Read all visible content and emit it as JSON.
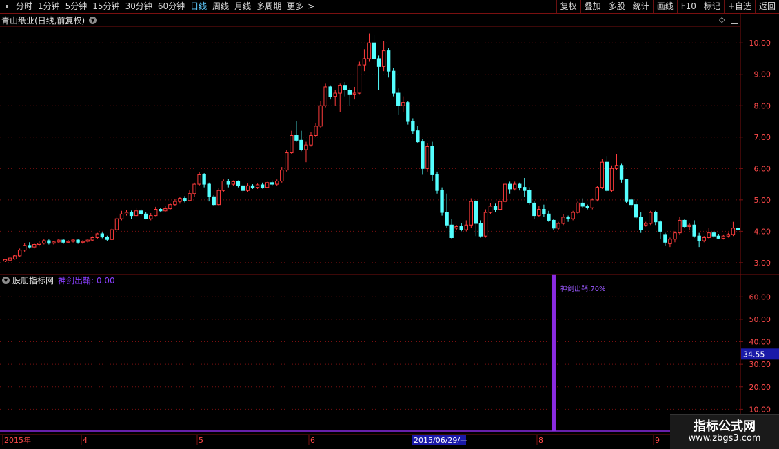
{
  "toolbar": {
    "periods": [
      "分时",
      "1分钟",
      "5分钟",
      "15分钟",
      "30分钟",
      "60分钟",
      "日线",
      "周线",
      "月线",
      "多周期",
      "更多"
    ],
    "active_period": "日线",
    "right_buttons": [
      "复权",
      "叠加",
      "多股",
      "统计",
      "画线",
      "F10",
      "标记",
      "+自选",
      "返回"
    ]
  },
  "main_title": "青山纸业(日线,前复权)",
  "sub_panel": {
    "name": "股朋指标网",
    "indicator": "神剑出鞘: 0.00",
    "spike_label": "神剑出鞘:70%",
    "current_value": "34.55"
  },
  "x_axis": {
    "labels": [
      "2015年",
      "4",
      "5",
      "6",
      "2015/06/29/—",
      "8",
      "9"
    ]
  },
  "watermark": {
    "title": "指标公式网",
    "url": "www.zbgs3.com"
  },
  "colors": {
    "up": "#ff3c3c",
    "down": "#54ffff",
    "grid": "#7a1010",
    "axis_text": "#ff4a4a",
    "indicator": "#8a2be2",
    "bg": "#000000"
  },
  "chart_data": {
    "type": "candlestick",
    "main": {
      "ylim": [
        2.8,
        10.4
      ],
      "yticks": [
        "3.00",
        "4.00",
        "5.00",
        "6.00",
        "7.00",
        "8.00",
        "9.00",
        "10.00"
      ],
      "candles": [
        [
          3.05,
          3.1,
          3.02,
          3.12
        ],
        [
          3.08,
          3.15,
          3.05,
          3.18
        ],
        [
          3.12,
          3.22,
          3.1,
          3.25
        ],
        [
          3.22,
          3.4,
          3.18,
          3.45
        ],
        [
          3.4,
          3.55,
          3.35,
          3.62
        ],
        [
          3.55,
          3.5,
          3.45,
          3.65
        ],
        [
          3.5,
          3.58,
          3.45,
          3.62
        ],
        [
          3.58,
          3.62,
          3.52,
          3.68
        ],
        [
          3.62,
          3.7,
          3.58,
          3.75
        ],
        [
          3.7,
          3.62,
          3.58,
          3.74
        ],
        [
          3.62,
          3.66,
          3.58,
          3.7
        ],
        [
          3.66,
          3.72,
          3.62,
          3.76
        ],
        [
          3.72,
          3.65,
          3.6,
          3.75
        ],
        [
          3.65,
          3.68,
          3.62,
          3.72
        ],
        [
          3.68,
          3.72,
          3.64,
          3.76
        ],
        [
          3.72,
          3.65,
          3.6,
          3.75
        ],
        [
          3.65,
          3.68,
          3.6,
          3.72
        ],
        [
          3.68,
          3.72,
          3.64,
          3.75
        ],
        [
          3.72,
          3.8,
          3.68,
          3.84
        ],
        [
          3.8,
          3.92,
          3.76,
          3.95
        ],
        [
          3.92,
          3.82,
          3.78,
          3.96
        ],
        [
          3.82,
          3.74,
          3.7,
          3.86
        ],
        [
          3.74,
          4.05,
          3.72,
          4.1
        ],
        [
          4.05,
          4.4,
          4.02,
          4.48
        ],
        [
          4.4,
          4.55,
          4.35,
          4.65
        ],
        [
          4.55,
          4.6,
          4.5,
          4.68
        ],
        [
          4.6,
          4.5,
          4.4,
          4.66
        ],
        [
          4.5,
          4.65,
          4.45,
          4.75
        ],
        [
          4.65,
          4.55,
          4.5,
          4.7
        ],
        [
          4.55,
          4.4,
          4.38,
          4.6
        ],
        [
          4.4,
          4.5,
          4.35,
          4.58
        ],
        [
          4.5,
          4.7,
          4.48,
          4.78
        ],
        [
          4.7,
          4.65,
          4.6,
          4.75
        ],
        [
          4.65,
          4.72,
          4.6,
          4.8
        ],
        [
          4.72,
          4.85,
          4.68,
          4.9
        ],
        [
          4.85,
          4.95,
          4.8,
          5.02
        ],
        [
          4.95,
          5.05,
          4.88,
          5.1
        ],
        [
          5.05,
          4.98,
          4.92,
          5.12
        ],
        [
          4.98,
          5.2,
          4.95,
          5.3
        ],
        [
          5.2,
          5.5,
          5.1,
          5.55
        ],
        [
          5.5,
          5.8,
          5.45,
          5.88
        ],
        [
          5.8,
          5.5,
          5.4,
          5.85
        ],
        [
          5.5,
          5.1,
          4.95,
          5.55
        ],
        [
          5.1,
          4.85,
          4.8,
          5.15
        ],
        [
          4.85,
          5.3,
          4.82,
          5.38
        ],
        [
          5.3,
          5.6,
          5.25,
          5.65
        ],
        [
          5.6,
          5.5,
          5.4,
          5.66
        ],
        [
          5.5,
          5.58,
          5.45,
          5.62
        ],
        [
          5.58,
          5.45,
          5.4,
          5.62
        ],
        [
          5.45,
          5.3,
          5.22,
          5.5
        ],
        [
          5.3,
          5.45,
          5.25,
          5.52
        ],
        [
          5.45,
          5.4,
          5.35,
          5.5
        ],
        [
          5.4,
          5.48,
          5.35,
          5.52
        ],
        [
          5.48,
          5.4,
          5.36,
          5.55
        ],
        [
          5.4,
          5.55,
          5.38,
          5.6
        ],
        [
          5.55,
          5.5,
          5.45,
          5.62
        ],
        [
          5.5,
          5.6,
          5.45,
          5.65
        ],
        [
          5.6,
          5.95,
          5.55,
          6.05
        ],
        [
          5.95,
          6.5,
          5.9,
          6.6
        ],
        [
          6.5,
          7.05,
          6.45,
          7.2
        ],
        [
          7.05,
          6.9,
          6.85,
          7.5
        ],
        [
          6.9,
          6.6,
          6.55,
          7.2
        ],
        [
          6.6,
          6.75,
          6.2,
          6.85
        ],
        [
          6.75,
          7.05,
          6.7,
          7.15
        ],
        [
          7.05,
          7.35,
          7.0,
          7.45
        ],
        [
          7.35,
          8.0,
          7.3,
          8.15
        ],
        [
          8.0,
          8.6,
          7.95,
          8.7
        ],
        [
          8.6,
          8.3,
          8.2,
          8.65
        ],
        [
          8.3,
          8.4,
          8.0,
          8.5
        ],
        [
          8.4,
          8.65,
          7.8,
          8.7
        ],
        [
          8.65,
          8.5,
          8.3,
          8.75
        ],
        [
          8.5,
          8.35,
          8.0,
          8.55
        ],
        [
          8.35,
          8.4,
          8.2,
          8.6
        ],
        [
          8.4,
          9.3,
          8.35,
          9.4
        ],
        [
          9.3,
          9.5,
          9.1,
          9.8
        ],
        [
          9.5,
          10.0,
          9.4,
          10.3
        ],
        [
          10.0,
          9.5,
          9.3,
          10.25
        ],
        [
          9.5,
          9.25,
          8.5,
          9.6
        ],
        [
          9.25,
          9.75,
          9.1,
          10.05
        ],
        [
          9.75,
          9.1,
          8.9,
          9.85
        ],
        [
          9.1,
          8.4,
          8.3,
          9.2
        ],
        [
          8.4,
          8.0,
          7.7,
          8.55
        ],
        [
          8.0,
          8.1,
          7.8,
          8.3
        ],
        [
          8.1,
          7.5,
          7.4,
          8.15
        ],
        [
          7.5,
          7.2,
          7.1,
          7.6
        ],
        [
          7.2,
          6.85,
          6.8,
          7.35
        ],
        [
          6.85,
          6.0,
          5.8,
          6.95
        ],
        [
          6.0,
          6.7,
          5.9,
          6.8
        ],
        [
          6.7,
          5.8,
          5.6,
          6.85
        ],
        [
          5.8,
          5.3,
          5.2,
          5.9
        ],
        [
          5.3,
          4.6,
          4.5,
          5.4
        ],
        [
          4.6,
          4.2,
          4.1,
          5.2
        ],
        [
          4.2,
          3.8,
          3.75,
          4.4
        ],
        [
          4.1,
          4.15,
          4.05,
          4.2
        ],
        [
          4.15,
          4.05,
          4.0,
          4.25
        ],
        [
          4.05,
          4.2,
          4.0,
          4.35
        ],
        [
          4.2,
          4.95,
          4.1,
          5.05
        ],
        [
          4.95,
          4.25,
          3.85,
          5.0
        ],
        [
          4.25,
          3.85,
          3.8,
          4.35
        ],
        [
          3.85,
          4.6,
          3.8,
          4.7
        ],
        [
          4.6,
          4.8,
          4.55,
          4.9
        ],
        [
          4.8,
          4.7,
          4.6,
          4.88
        ],
        [
          4.7,
          4.95,
          4.65,
          5.05
        ],
        [
          4.95,
          5.5,
          4.9,
          5.55
        ],
        [
          5.5,
          5.35,
          5.2,
          5.58
        ],
        [
          5.35,
          5.5,
          5.3,
          5.58
        ],
        [
          5.5,
          5.4,
          5.3,
          5.55
        ],
        [
          5.4,
          5.3,
          5.1,
          5.7
        ],
        [
          5.3,
          4.9,
          4.85,
          5.4
        ],
        [
          4.9,
          4.5,
          4.4,
          4.95
        ],
        [
          4.5,
          4.7,
          4.45,
          4.8
        ],
        [
          4.7,
          4.55,
          4.45,
          4.85
        ],
        [
          4.55,
          4.35,
          4.3,
          4.65
        ],
        [
          4.35,
          4.1,
          4.05,
          4.4
        ],
        [
          4.1,
          4.25,
          4.05,
          4.3
        ],
        [
          4.25,
          4.45,
          4.2,
          4.55
        ],
        [
          4.45,
          4.4,
          4.3,
          4.5
        ],
        [
          4.4,
          4.6,
          4.35,
          4.65
        ],
        [
          4.6,
          4.9,
          4.55,
          4.95
        ],
        [
          4.9,
          4.8,
          4.75,
          5.05
        ],
        [
          4.8,
          4.75,
          4.7,
          4.85
        ],
        [
          4.75,
          5.0,
          4.7,
          5.05
        ],
        [
          5.0,
          5.4,
          4.95,
          5.45
        ],
        [
          5.4,
          6.2,
          5.35,
          6.3
        ],
        [
          6.2,
          5.3,
          5.25,
          6.4
        ],
        [
          5.3,
          6.0,
          5.25,
          6.1
        ],
        [
          6.0,
          6.1,
          5.95,
          6.45
        ],
        [
          6.1,
          5.65,
          5.55,
          6.15
        ],
        [
          5.65,
          4.95,
          4.9,
          5.3
        ],
        [
          5.0,
          4.85,
          4.75,
          5.05
        ],
        [
          4.85,
          4.45,
          4.4,
          4.95
        ],
        [
          4.45,
          4.05,
          3.95,
          4.6
        ],
        [
          4.2,
          4.25,
          4.15,
          4.3
        ],
        [
          4.25,
          4.6,
          4.2,
          4.65
        ],
        [
          4.6,
          4.3,
          4.2,
          4.65
        ],
        [
          4.3,
          4.0,
          3.75,
          4.35
        ],
        [
          3.9,
          3.65,
          3.55,
          3.95
        ],
        [
          3.6,
          3.75,
          3.5,
          3.8
        ],
        [
          3.75,
          3.95,
          3.65,
          4.0
        ],
        [
          3.95,
          4.35,
          3.9,
          4.45
        ],
        [
          4.35,
          4.15,
          4.1,
          4.4
        ],
        [
          4.15,
          4.2,
          4.05,
          4.25
        ],
        [
          4.2,
          3.85,
          3.8,
          4.35
        ],
        [
          3.85,
          3.7,
          3.5,
          3.95
        ],
        [
          3.7,
          3.8,
          3.65,
          3.85
        ],
        [
          3.8,
          3.95,
          3.75,
          4.1
        ],
        [
          3.95,
          3.85,
          3.8,
          4.0
        ],
        [
          3.85,
          3.78,
          3.75,
          3.92
        ],
        [
          3.78,
          3.85,
          3.74,
          3.9
        ],
        [
          3.85,
          3.9,
          3.8,
          3.95
        ],
        [
          3.9,
          4.1,
          3.85,
          4.3
        ],
        [
          4.1,
          4.05,
          3.95,
          4.15
        ]
      ]
    },
    "sub": {
      "ylim": [
        0,
        65
      ],
      "yticks": [
        "10.00",
        "20.00",
        "30.00",
        "40.00",
        "50.00",
        "60.00"
      ],
      "spike_at_index": 113,
      "spike_value": 70
    }
  }
}
